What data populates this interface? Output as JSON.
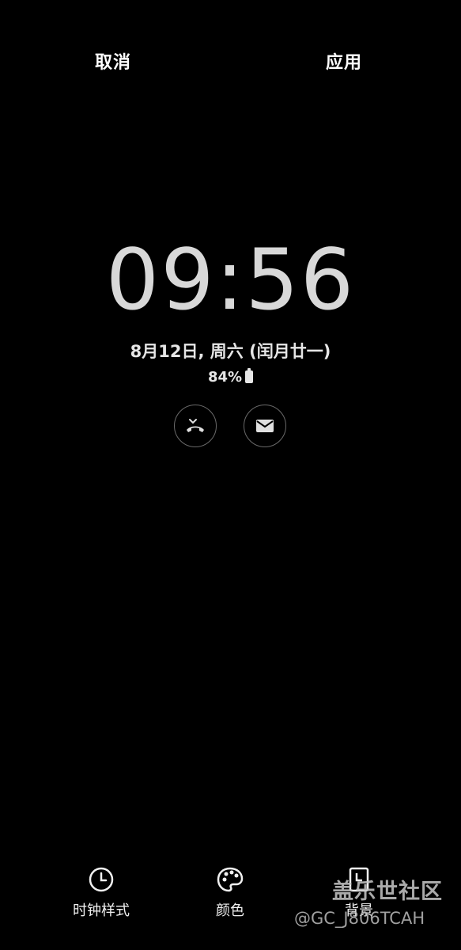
{
  "top_bar": {
    "cancel_label": "取消",
    "apply_label": "应用"
  },
  "clock": {
    "time": "09:56"
  },
  "date": {
    "text": "8月12日, 周六 (闰月廿一)"
  },
  "battery": {
    "percent": "84%",
    "level": 0.84
  },
  "notifications": [
    {
      "icon": "missed-call-icon"
    },
    {
      "icon": "mail-icon"
    }
  ],
  "bottom_bar": {
    "items": [
      {
        "label": "时钟样式",
        "icon": "clock-icon"
      },
      {
        "label": "颜色",
        "icon": "palette-icon"
      },
      {
        "label": "背景",
        "icon": "background-icon"
      }
    ]
  },
  "watermark": {
    "brand": "盖乐世社区",
    "user": "@GC_J806TCAH"
  },
  "colors": {
    "background": "#000000",
    "text": "#ffffff",
    "clock": "#d8d8d8",
    "ring": "#6a6a6a"
  }
}
